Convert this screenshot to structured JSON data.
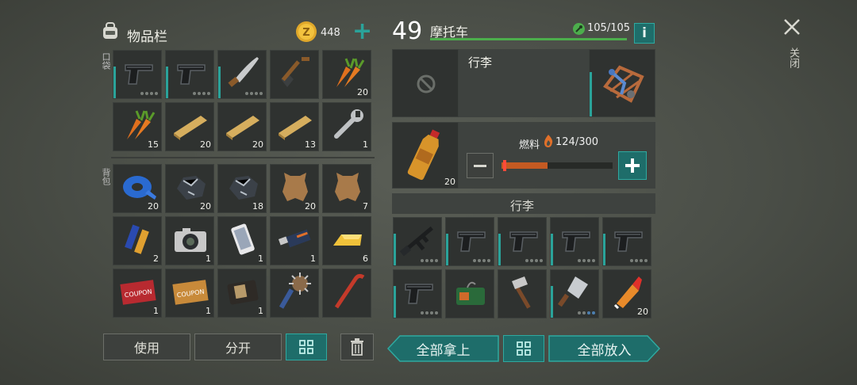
{
  "inventory": {
    "title": "物品栏",
    "coins": "448",
    "plus": "+",
    "pocket_label": "口袋",
    "backpack_label": "背包",
    "pocket_items": [
      {
        "icon": "pistol-icon",
        "count": "",
        "dots": 4
      },
      {
        "icon": "pistol-icon",
        "count": "",
        "dots": 4
      },
      {
        "icon": "machete-icon",
        "count": "",
        "dots": 3
      },
      {
        "icon": "shovel-icon",
        "count": "",
        "dots": 0
      },
      {
        "icon": "carrot-icon",
        "count": "20",
        "dots": 0
      },
      {
        "icon": "carrot-icon",
        "count": "15",
        "dots": 0
      },
      {
        "icon": "plank-icon",
        "count": "20",
        "dots": 0
      },
      {
        "icon": "plank-icon",
        "count": "20",
        "dots": 0
      },
      {
        "icon": "plank-icon",
        "count": "13",
        "dots": 0
      },
      {
        "icon": "wrench-icon",
        "count": "1",
        "dots": 0
      }
    ],
    "backpack_items": [
      {
        "icon": "tape-icon",
        "count": "20",
        "dots": 0
      },
      {
        "icon": "iron-ore-icon",
        "count": "20",
        "dots": 0
      },
      {
        "icon": "iron-ore-icon",
        "count": "18",
        "dots": 0
      },
      {
        "icon": "leather-icon",
        "count": "20",
        "dots": 0
      },
      {
        "icon": "leather-icon",
        "count": "7",
        "dots": 0
      },
      {
        "icon": "batteries-icon",
        "count": "2",
        "dots": 0
      },
      {
        "icon": "camera-icon",
        "count": "1",
        "dots": 0
      },
      {
        "icon": "smartphone-icon",
        "count": "1",
        "dots": 0
      },
      {
        "icon": "usb-drive-icon",
        "count": "1",
        "dots": 0
      },
      {
        "icon": "gold-bar-icon",
        "count": "6",
        "dots": 0
      },
      {
        "icon": "coupon-red-icon",
        "count": "1",
        "dots": 0,
        "text": "COUPON"
      },
      {
        "icon": "coupon-gold-icon",
        "count": "1",
        "dots": 0,
        "text": "COUPON"
      },
      {
        "icon": "wallet-icon",
        "count": "1",
        "dots": 0
      },
      {
        "icon": "spiked-club-icon",
        "count": "",
        "dots": 0
      },
      {
        "icon": "crowbar-icon",
        "count": "",
        "dots": 0
      }
    ],
    "btn_use": "使用",
    "btn_split": "分开"
  },
  "vehicle": {
    "level": "49",
    "name": "摩托车",
    "hp": "105/105",
    "hp_fraction": 1.0,
    "info": "i",
    "luggage_title": "行李",
    "fuel_label": "燃料",
    "fuel_value": "124/300",
    "fuel_fraction": 0.413,
    "fuel_item_count": "20",
    "storage_header": "行李",
    "storage_items": [
      {
        "icon": "rifle-icon",
        "count": "",
        "dots": 4
      },
      {
        "icon": "pistol-icon",
        "count": "",
        "dots": 4
      },
      {
        "icon": "pistol-icon",
        "count": "",
        "dots": 4
      },
      {
        "icon": "pistol-icon",
        "count": "",
        "dots": 4
      },
      {
        "icon": "pistol-icon",
        "count": "",
        "dots": 4
      },
      {
        "icon": "pistol-icon",
        "count": "",
        "dots": 4
      },
      {
        "icon": "explosive-box-icon",
        "count": "",
        "dots": 0
      },
      {
        "icon": "hatchet-icon",
        "count": "",
        "dots": 0
      },
      {
        "icon": "cleaver-icon",
        "count": "",
        "dots": 2
      },
      {
        "icon": "glue-icon",
        "count": "20",
        "dots": 0
      }
    ],
    "btn_take_all": "全部拿上",
    "btn_put_all": "全部放入"
  },
  "close": {
    "label": "关闭"
  },
  "colors": {
    "accent": "#2aa39a",
    "hp_bar": "#4cae4c",
    "fuel": "#e0702a"
  }
}
